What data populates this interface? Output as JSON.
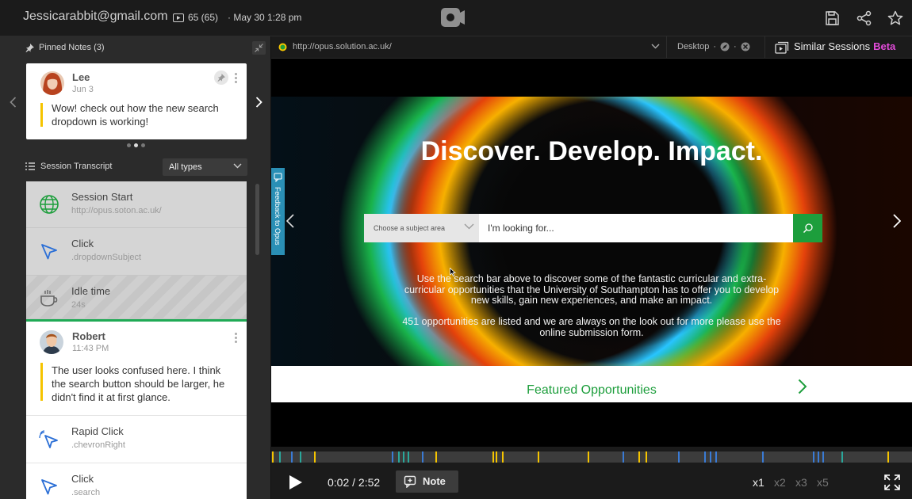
{
  "topbar": {
    "user_email": "Jessicarabbit@gmail.com",
    "session_count": "65 (65)",
    "session_date": "May 30 1:28 pm"
  },
  "pinned": {
    "header": "Pinned Notes (3)",
    "note": {
      "author": "Lee",
      "date": "Jun 3",
      "text": "Wow! check out how the new search dropdown is working!"
    }
  },
  "transcript": {
    "header": "Session Transcript",
    "filter_value": "All types",
    "items": [
      {
        "title": "Session Start",
        "sub": "http://opus.soton.ac.uk/"
      },
      {
        "title": "Click",
        "sub": ".dropdownSubject"
      },
      {
        "title": "Idle time",
        "sub": "24s"
      },
      {
        "author": "Robert",
        "time": "11:43 PM",
        "text": "The user looks confused here. I think the search button should be larger, he didn't find it at first glance."
      },
      {
        "title": "Rapid Click",
        "sub": ".chevronRight"
      },
      {
        "title": "Click",
        "sub": ".search"
      }
    ]
  },
  "urlbar": {
    "url": "http://opus.solution.ac.uk/",
    "device": "Desktop",
    "similar_label": "Similar Sessions",
    "beta_label": "Beta"
  },
  "page": {
    "hero_title": "Discover. Develop. Impact.",
    "subject_placeholder": "Choose a subject area",
    "search_value": "I'm looking for...",
    "paragraph1": "Use the search bar above to discover some of the fantastic curricular and extra-curricular opportunities that the University of Southampton has to offer you to develop new skills, gain new experiences, and make an impact.",
    "paragraph2": "451 opportunities are listed and we are always on the look out for more please use the online submission form.",
    "feedback_tab": "Feedback to Opus",
    "featured": "Featured Opportunities"
  },
  "player": {
    "time": "0:02 / 2:52",
    "note_label": "Note",
    "speeds": [
      "x1",
      "x2",
      "x3",
      "x5"
    ],
    "active_speed": "x1",
    "progress_fraction": 0.012
  },
  "colors": {
    "accent_green": "#1d9e3c",
    "beta_pink": "#e24bd9",
    "quote_yellow": "#f5c400",
    "timeline_yellow": "#f5c400",
    "timeline_blue": "#3a7bd5",
    "timeline_teal": "#2aa79b"
  },
  "icons": [
    "pin-icon",
    "collapse-icon",
    "chevron-left-icon",
    "chevron-right-icon",
    "list-icon",
    "globe-icon",
    "cursor-icon",
    "coffee-icon",
    "rapid-click-icon",
    "save-icon",
    "share-icon",
    "star-icon",
    "play-icon",
    "note-icon",
    "fullscreen-icon",
    "search-icon",
    "similar-sessions-icon"
  ]
}
